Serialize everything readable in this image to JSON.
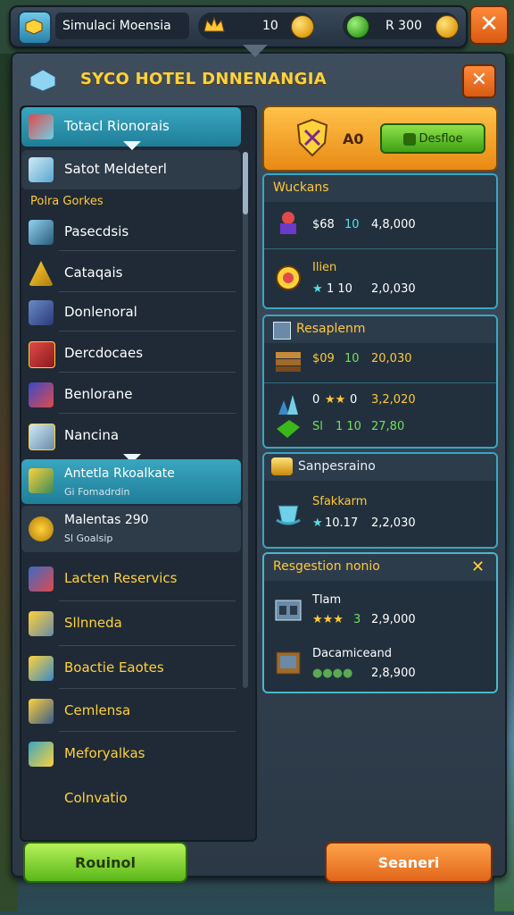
{
  "hud": {
    "title": "Simulaci Moensia",
    "coins": "10",
    "gems": "R 300"
  },
  "panel": {
    "title": "SYCO HOTEL DNNENANGIA"
  },
  "list": {
    "selected": "Totacl Rionorais",
    "sub": "Satot Meldeterl",
    "section": "Polra Gorkes",
    "items": [
      "Pasecdsis",
      "Cataqais",
      "Donlenoral",
      "Dercdocaes",
      "Benlorane",
      "Nancina"
    ],
    "selected2": "Antetla Rkoalkate",
    "selected2_sub": "Gi Fomadrdin",
    "item_mal": "Malentas 290",
    "item_mal_sub": "Sl Goalsip",
    "gold_items": [
      "Lacten Reservics",
      "Sllnneda",
      "Boactie Eaotes",
      "Cemlensa",
      "Meforyalkas",
      "Colnvatio"
    ]
  },
  "top_card": {
    "value": "A0",
    "button": "Desfloe"
  },
  "card1": {
    "title": "Wuckans",
    "e1": {
      "a": "$68",
      "b": "10",
      "c": "4,8,000"
    },
    "e2": {
      "name": "Ilien",
      "a": "1 10",
      "c": "2,0,030"
    }
  },
  "card2": {
    "title": "Resaplenm",
    "e1": {
      "a": "$09",
      "b": "10",
      "c": "20,030"
    },
    "e2": {
      "a": "0",
      "b": "0",
      "c": "3,2,020"
    },
    "e3": {
      "a": "Sl",
      "b": "1 10",
      "c": "27,80"
    }
  },
  "card3": {
    "title": "Sanpesraino",
    "e1": {
      "name": "Sfakkarm",
      "a": "10.17",
      "c": "2,2,030"
    }
  },
  "card4": {
    "title": "Resgestion nonio",
    "e1": {
      "name": "Tlam",
      "a": "3",
      "c": "2,9,000"
    },
    "e2": {
      "name": "Dacamiceand",
      "c": "2,8,900"
    }
  },
  "buttons": {
    "left": "Rouinol",
    "right": "Seaneri"
  },
  "colors": {
    "accent": "#3aa6c0",
    "gold": "#ffc83a",
    "orange": "#e0661a",
    "green": "#5ab81a"
  }
}
